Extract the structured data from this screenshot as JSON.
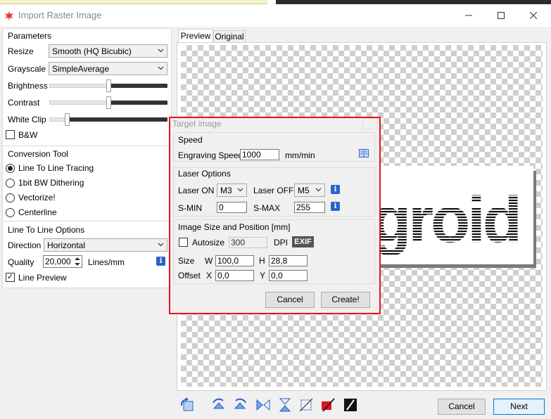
{
  "window": {
    "title": "Import Raster Image",
    "minimize_icon": "minimize-icon",
    "maximize_icon": "maximize-icon",
    "close_icon": "close-icon"
  },
  "parameters": {
    "header": "Parameters",
    "resize_label": "Resize",
    "resize_value": "Smooth (HQ Bicubic)",
    "grayscale_label": "Grayscale",
    "grayscale_value": "SimpleAverage",
    "brightness_label": "Brightness",
    "brightness_level": 0.5,
    "contrast_label": "Contrast",
    "contrast_level": 0.5,
    "whiteclip_label": "White Clip",
    "whiteclip_level": 0.15,
    "bw_label": "B&W",
    "bw_checked": false
  },
  "conversion": {
    "header": "Conversion Tool",
    "options": [
      {
        "label": "Line To Line Tracing",
        "selected": true
      },
      {
        "label": "1bit BW Dithering",
        "selected": false
      },
      {
        "label": "Vectorize!",
        "selected": false
      },
      {
        "label": "Centerline",
        "selected": false
      }
    ]
  },
  "line_options": {
    "header": "Line To Line Options",
    "direction_label": "Direction",
    "direction_value": "Horizontal",
    "quality_label": "Quality",
    "quality_value": "20,000",
    "quality_unit": "Lines/mm",
    "preview_label": "Line Preview",
    "preview_checked": true
  },
  "tabs": {
    "preview": "Preview",
    "original": "Original"
  },
  "preview_text": "groid",
  "target_dialog": {
    "title": "Target image",
    "speed_header": "Speed",
    "engraving_speed_label": "Engraving Speed",
    "engraving_speed_value": "1000",
    "speed_unit": "mm/min",
    "laser_header": "Laser Options",
    "laser_on_label": "Laser ON",
    "laser_on_value": "M3",
    "laser_off_label": "Laser OFF",
    "laser_off_value": "M5",
    "smin_label": "S-MIN",
    "smin_value": "0",
    "smax_label": "S-MAX",
    "smax_value": "255",
    "size_header": "Image Size and Position [mm]",
    "autosize_label": "Autosize",
    "dpi_value": "300",
    "dpi_label": "DPI",
    "exif_label": "EXIF",
    "size_label": "Size",
    "w_label": "W",
    "w_value": "100,0",
    "h_label": "H",
    "h_value": "28,8",
    "offset_label": "Offset",
    "x_label": "X",
    "x_value": "0,0",
    "y_label": "Y",
    "y_value": "0,0",
    "cancel_label": "Cancel",
    "create_label": "Create!"
  },
  "footer": {
    "cancel_label": "Cancel",
    "next_label": "Next",
    "tool_icons": [
      "rotate-icon",
      "rotate-left-icon",
      "rotate-right-icon",
      "flip-horizontal-icon",
      "flip-vertical-icon",
      "crop-icon",
      "auto-trim-icon",
      "invert-icon"
    ]
  },
  "colors": {
    "accent_red": "#e0161b",
    "info_blue": "#2a62c9",
    "next_border": "#0078d7"
  }
}
